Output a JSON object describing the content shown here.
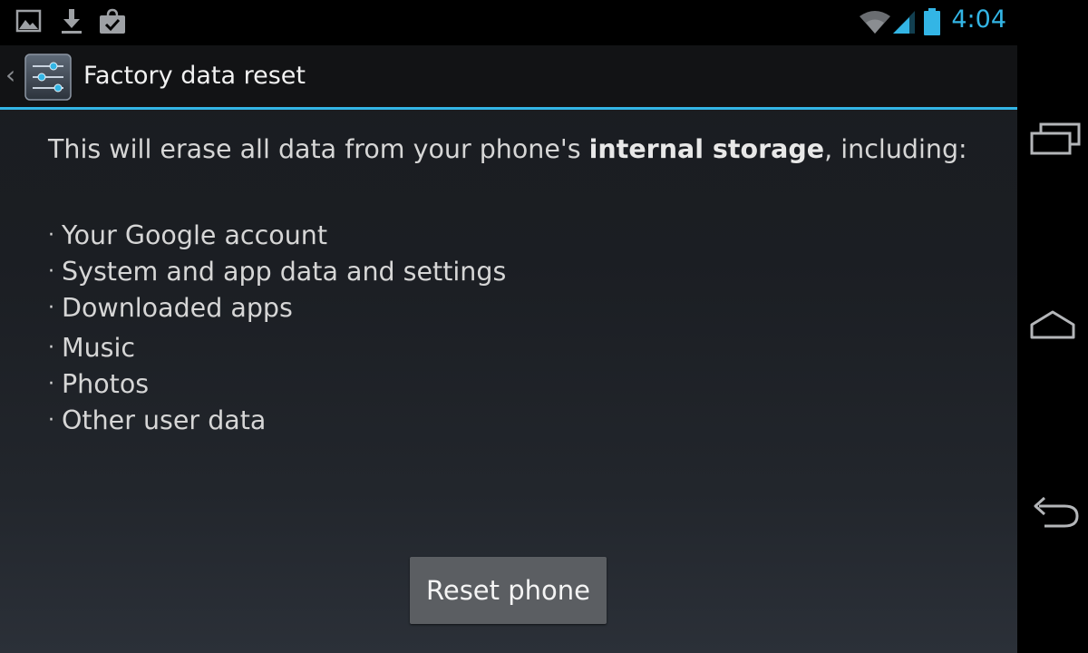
{
  "status_bar": {
    "left_icons": [
      "gallery-icon",
      "download-icon",
      "shopping-bag-icon"
    ],
    "right_icons": [
      "wifi-icon",
      "signal-icon",
      "battery-icon"
    ],
    "time": "4:04",
    "accent_color": "#33b5e5"
  },
  "action_bar": {
    "up_caret": "‹",
    "app_icon": "settings-sliders-icon",
    "title": "Factory data reset"
  },
  "content": {
    "warning_prefix": "This will erase all data from your phone's ",
    "warning_bold": "internal storage",
    "warning_suffix": ", including:",
    "bullet": "·",
    "items": [
      "Your Google account",
      "System and app data and settings",
      "Downloaded apps",
      "Music",
      "Photos",
      "Other user data"
    ]
  },
  "actions": {
    "reset_label": "Reset phone"
  },
  "nav_bar": {
    "buttons": [
      "recent-apps-icon",
      "home-icon",
      "back-icon"
    ]
  }
}
